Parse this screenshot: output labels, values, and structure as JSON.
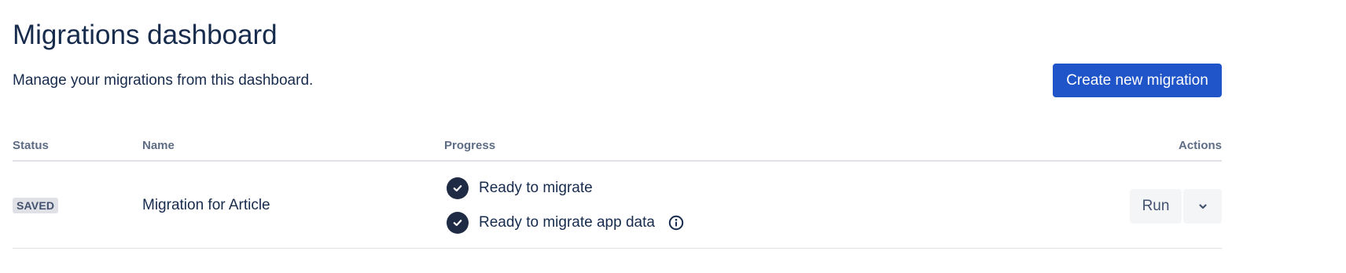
{
  "header": {
    "title": "Migrations dashboard",
    "subtitle": "Manage your migrations from this dashboard.",
    "create_button_label": "Create new migration"
  },
  "table": {
    "columns": {
      "status": "Status",
      "name": "Name",
      "progress": "Progress",
      "actions": "Actions"
    },
    "rows": [
      {
        "status": "SAVED",
        "name": "Migration for Article",
        "progress": [
          {
            "label": "Ready to migrate",
            "icon": "check-circle-icon"
          },
          {
            "label": "Ready to migrate app data",
            "icon": "check-circle-icon",
            "info_icon": "info-icon"
          }
        ],
        "actions": {
          "run_label": "Run",
          "more_icon": "chevron-down-icon"
        }
      }
    ]
  },
  "colors": {
    "primary": "#1f55c9",
    "text": "#172b4d",
    "subtle_text": "#5e6c84",
    "badge_bg": "#dfe1e6",
    "check_icon_bg": "#1f2a44",
    "secondary_button_bg": "#f4f5f7"
  }
}
